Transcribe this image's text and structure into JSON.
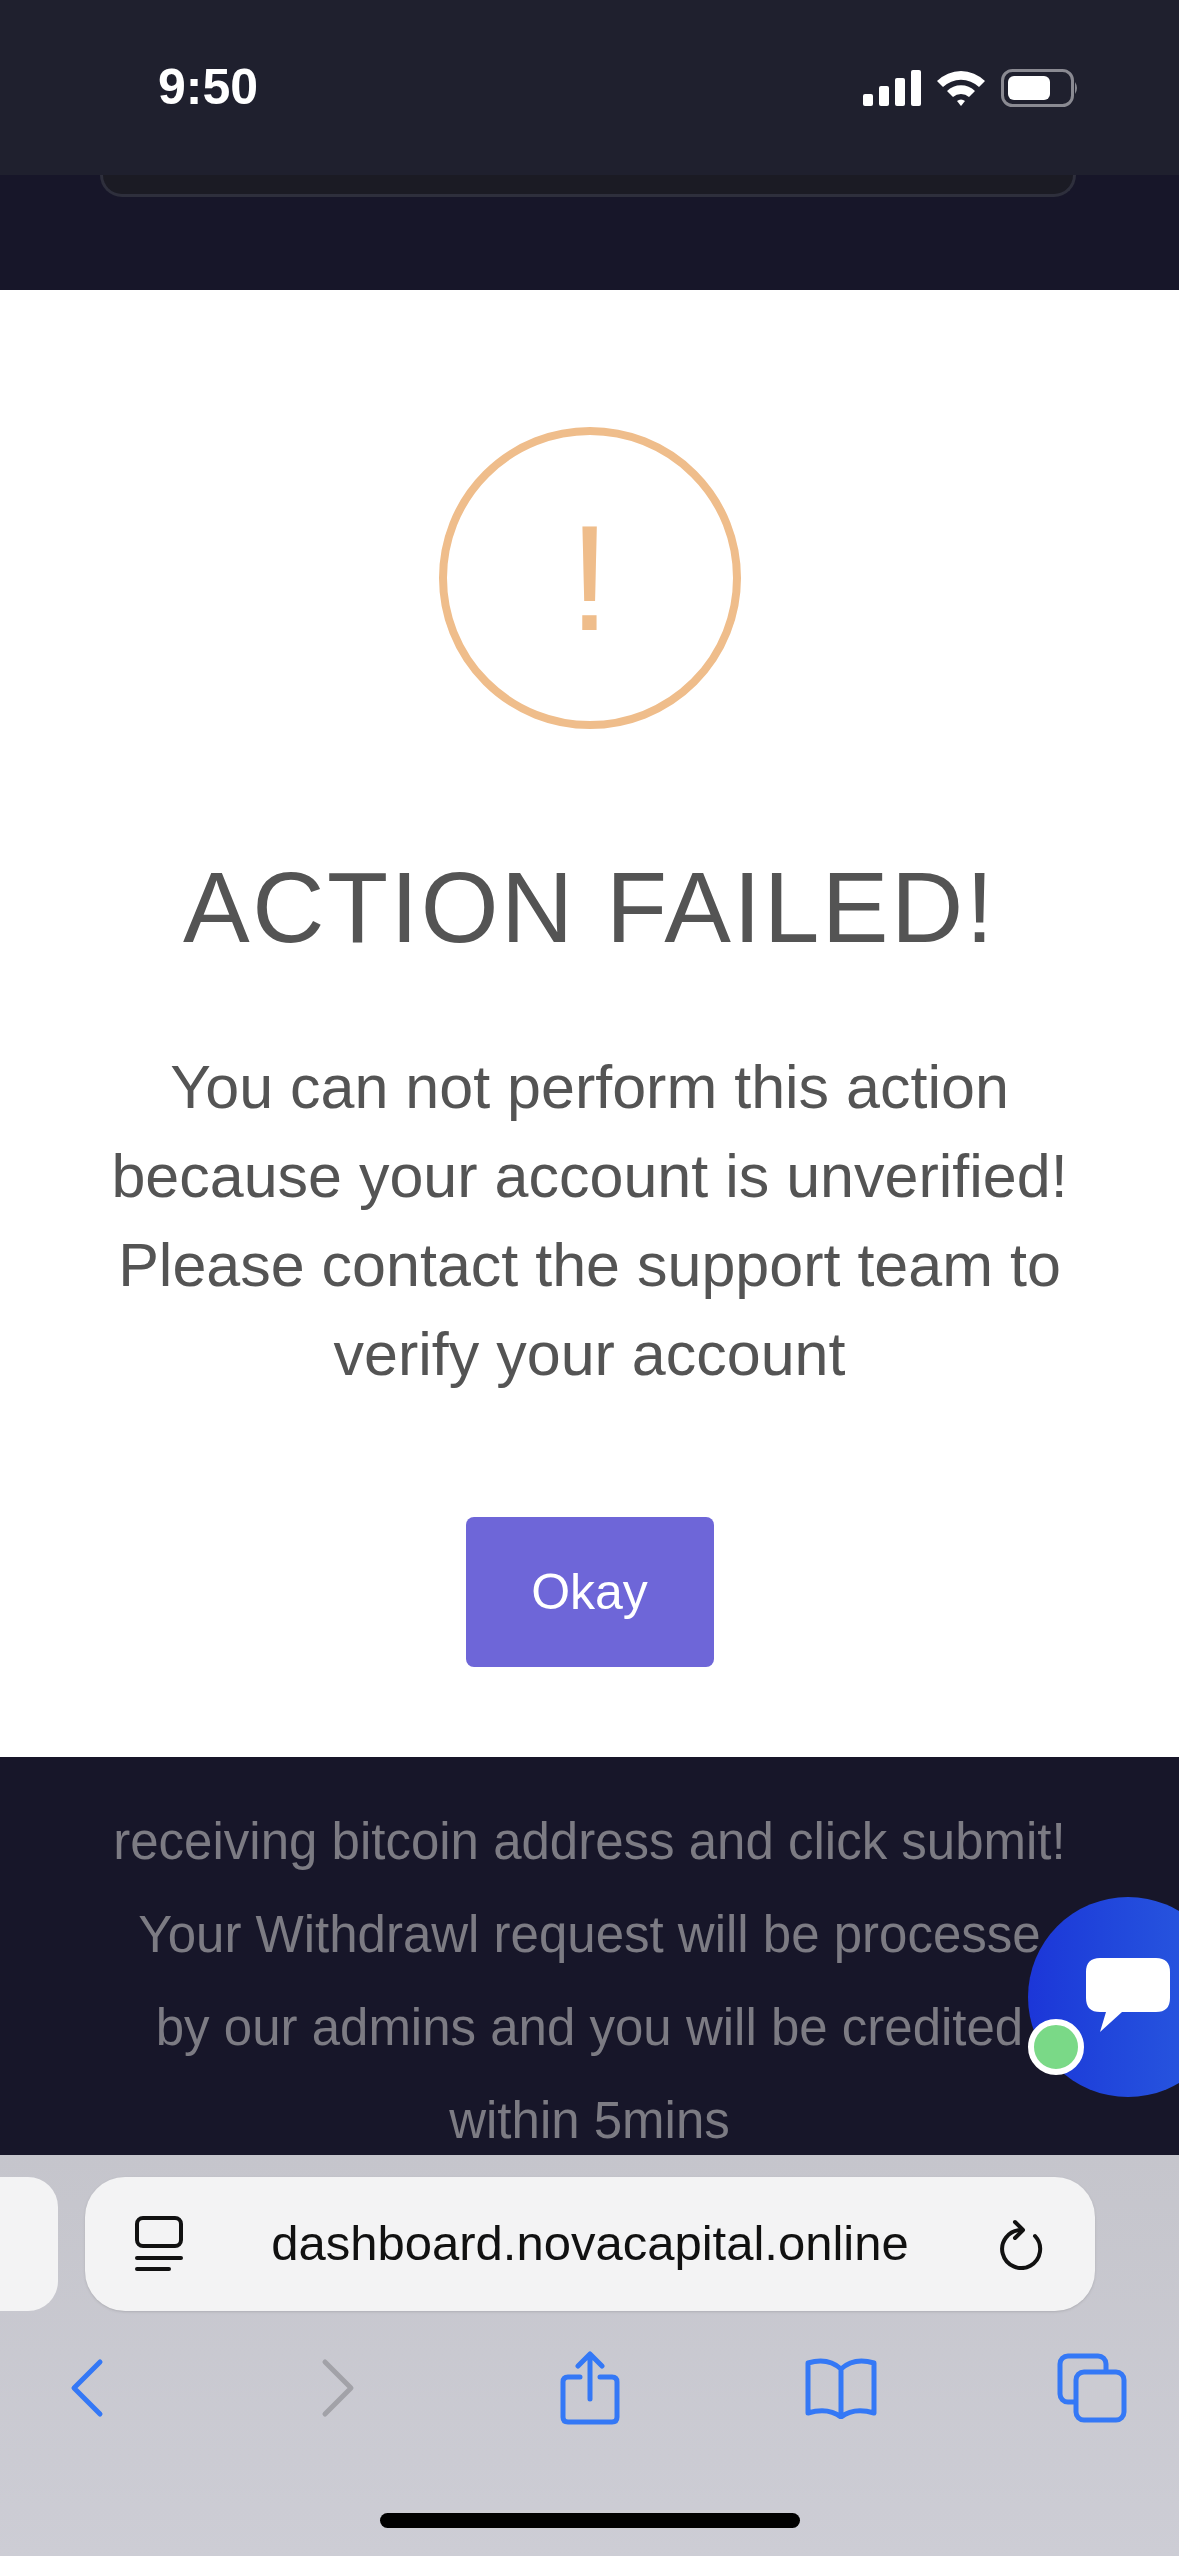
{
  "status_bar": {
    "time": "9:50"
  },
  "page_behind": {
    "notice_lines": [
      "receiving bitcoin address and click submit!",
      "Your Withdrawl request will be processe",
      "by our admins and you will be credited",
      "within 5mins"
    ]
  },
  "alert": {
    "icon": "!",
    "title": "ACTION FAILED!",
    "message": "You can not perform this action because your account is unverified! Please contact the support team to verify your account",
    "button": "Okay"
  },
  "chat_widget": {
    "online": true
  },
  "browser": {
    "url": "dashboard.novacapital.online",
    "back_disabled": false,
    "forward_disabled": true
  }
}
